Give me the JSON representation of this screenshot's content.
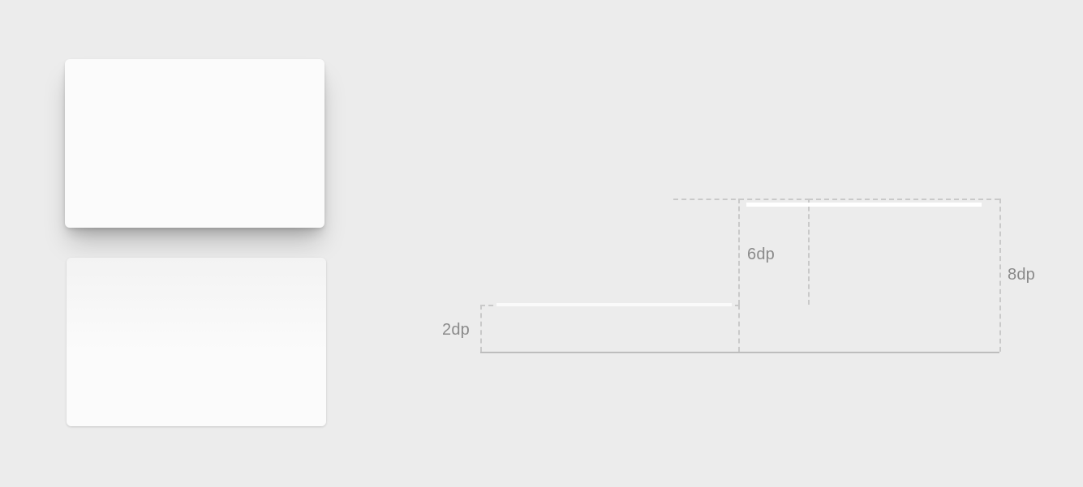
{
  "diagram": {
    "labels": {
      "tier2": "2dp",
      "tier6": "6dp",
      "tier8": "8dp"
    }
  },
  "cards": {
    "high_elevation_alt": "surface with high elevation (large shadow)",
    "low_elevation_alt": "surface with low elevation (small shadow)"
  }
}
